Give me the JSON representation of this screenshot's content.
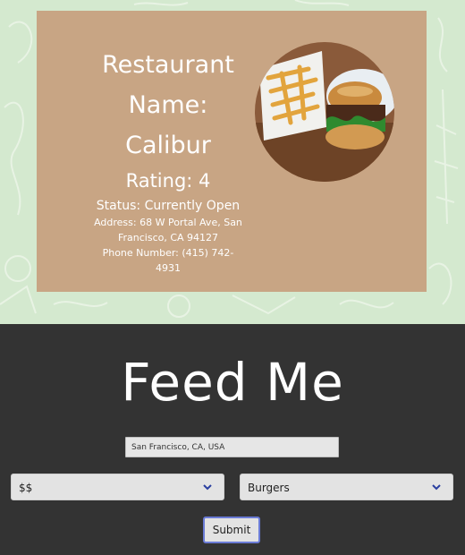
{
  "restaurant": {
    "name_line1": "Restaurant",
    "name_line2": "Name:",
    "name_line3": "Calibur",
    "rating": "Rating: 4",
    "status": "Status: Currently Open",
    "address_line1": "Address: 68 W Portal Ave, San",
    "address_line2": "Francisco, CA 94127",
    "phone": "Phone Number: (415) 742-4931",
    "photo_icon": "burger-and-fries-photo"
  },
  "app": {
    "title": "Feed Me"
  },
  "form": {
    "location_value": "San Francisco, CA, USA",
    "price_selected": "$$",
    "category_selected": "Burgers",
    "submit_label": "Submit"
  },
  "colors": {
    "top_background": "#d4e9cf",
    "card": "#c8a584",
    "bottom_background": "#333333",
    "submit_border": "#6a7bd6"
  }
}
